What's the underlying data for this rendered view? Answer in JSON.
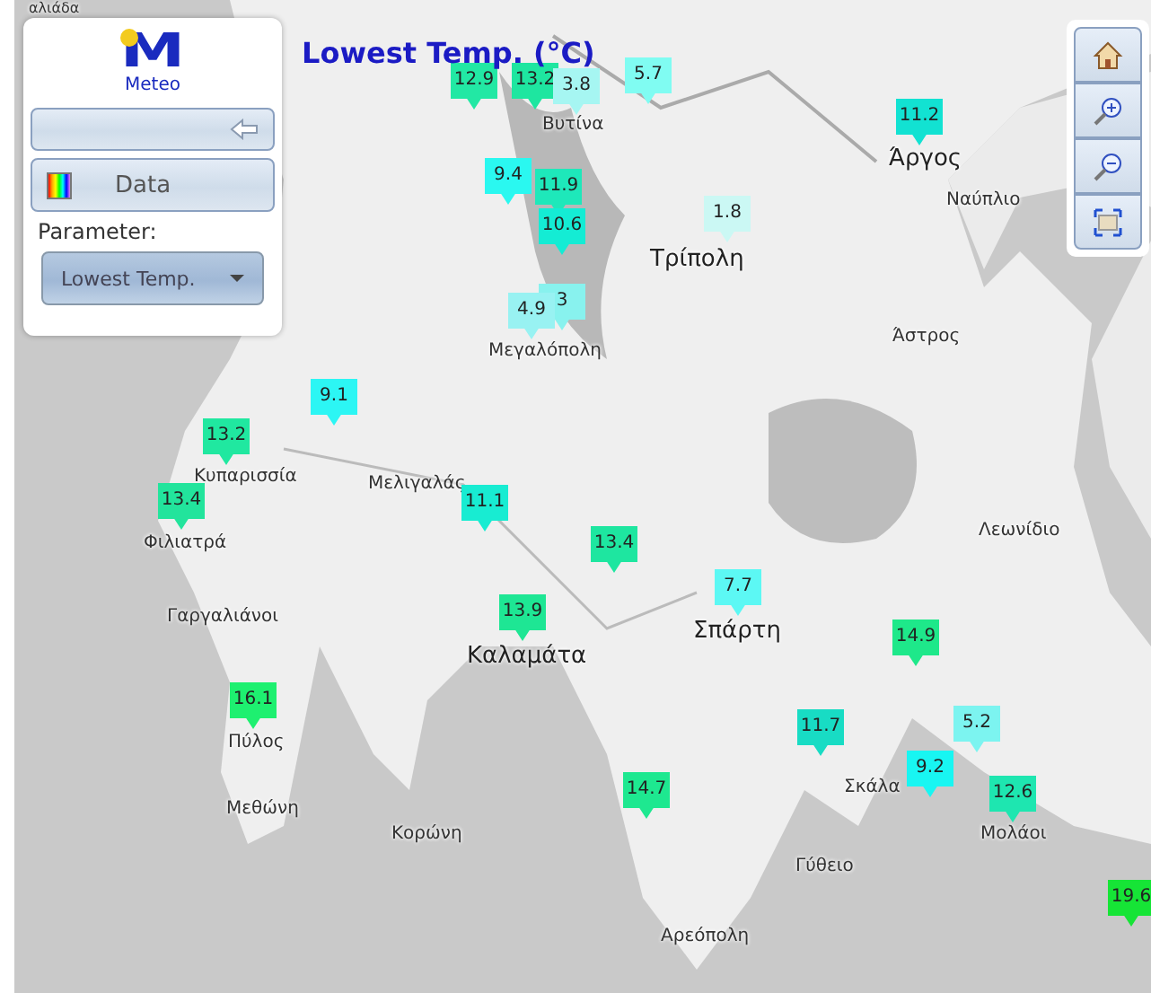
{
  "logo": {
    "mark": "M",
    "name": "Meteo"
  },
  "panel": {
    "data_button": "Data",
    "parameter_label": "Parameter:",
    "parameter_select": "Lowest Temp."
  },
  "title": "Lowest Temp. (°C)",
  "places": [
    {
      "name": "αλιάδα"
    },
    {
      "name": "Βυτίνα"
    },
    {
      "name": "Τρίπολη"
    },
    {
      "name": "Άργος"
    },
    {
      "name": "Ναύπλιο"
    },
    {
      "name": "Άστρος"
    },
    {
      "name": "Μεγαλόπολη"
    },
    {
      "name": "Κυπαρισσία"
    },
    {
      "name": "Μελιγαλάς"
    },
    {
      "name": "Φιλιατρά"
    },
    {
      "name": "Γαργαλιάνοι"
    },
    {
      "name": "Καλαμάτα"
    },
    {
      "name": "Σπάρτη"
    },
    {
      "name": "Λεωνίδιο"
    },
    {
      "name": "Πύλος"
    },
    {
      "name": "Μεθώνη"
    },
    {
      "name": "Κορώνη"
    },
    {
      "name": "Σκάλα"
    },
    {
      "name": "Μολάοι"
    },
    {
      "name": "Γύθειο"
    },
    {
      "name": "Αρεόπολη"
    }
  ],
  "markers": [
    {
      "value": "12.9",
      "color": "#22e8a4"
    },
    {
      "value": "13.2",
      "color": "#1ee6a0"
    },
    {
      "value": "3.8",
      "color": "#a6f6f2"
    },
    {
      "value": "5.7",
      "color": "#80fcf2"
    },
    {
      "value": "9.4",
      "color": "#2af8f0"
    },
    {
      "value": "11.9",
      "color": "#1ee8ba"
    },
    {
      "value": "10.6",
      "color": "#14ecd4"
    },
    {
      "value": "1.8",
      "color": "#cbf8f4"
    },
    {
      "value": "11.2",
      "color": "#12e2d2"
    },
    {
      "value": "3",
      "color": "#88f2ee"
    },
    {
      "value": "4.9",
      "color": "#98f2f2"
    },
    {
      "value": "9.1",
      "color": "#2cf6f4"
    },
    {
      "value": "13.2",
      "color": "#20e8a0"
    },
    {
      "value": "13.4",
      "color": "#22e49c"
    },
    {
      "value": "11.1",
      "color": "#18ecd2"
    },
    {
      "value": "13.4",
      "color": "#1ee6a0"
    },
    {
      "value": "7.7",
      "color": "#5cf8f4"
    },
    {
      "value": "13.9",
      "color": "#1ee694"
    },
    {
      "value": "14.9",
      "color": "#1ee88a"
    },
    {
      "value": "16.1",
      "color": "#1ef070"
    },
    {
      "value": "11.7",
      "color": "#18dcc4"
    },
    {
      "value": "5.2",
      "color": "#7cf4f0"
    },
    {
      "value": "9.2",
      "color": "#18f6f2"
    },
    {
      "value": "12.6",
      "color": "#1ee6b0"
    },
    {
      "value": "14.7",
      "color": "#1ee890"
    },
    {
      "value": "19.6",
      "color": "#16e436"
    }
  ]
}
